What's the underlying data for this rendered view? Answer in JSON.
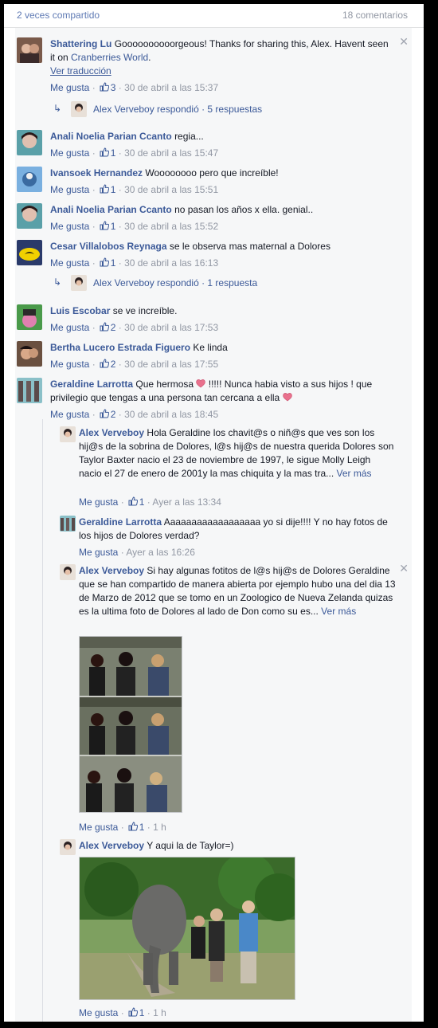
{
  "header": {
    "shares": "2 veces compartido",
    "comments": "18 comentarios"
  },
  "comments": [
    {
      "name": "Shattering Lu",
      "text": "Goooooooooorgeous! Thanks for sharing this, Alex. Havent seen it on ",
      "link": "Cranberries World",
      "tail": ".",
      "translate": "Ver traducción",
      "like": "Me gusta",
      "count": "3",
      "time": "30 de abril a las 15:37",
      "replies": "Alex Verveboy respondió · 5 respuestas"
    },
    {
      "name": "Anali Noelia Parian Ccanto",
      "text": "regia...",
      "like": "Me gusta",
      "count": "1",
      "time": "30 de abril a las 15:47"
    },
    {
      "name": "Ivansoek Hernandez",
      "text": "Woooooooo pero que increíble!",
      "like": "Me gusta",
      "count": "1",
      "time": "30 de abril a las 15:51"
    },
    {
      "name": "Anali Noelia Parian Ccanto",
      "text": "no pasan los años x ella. genial..",
      "like": "Me gusta",
      "count": "1",
      "time": "30 de abril a las 15:52"
    },
    {
      "name": "Cesar Villalobos Reynaga",
      "text": "se le observa mas maternal a Dolores",
      "like": "Me gusta",
      "count": "1",
      "time": "30 de abril a las 16:13",
      "replies": "Alex Verveboy respondió · 1 respuesta"
    },
    {
      "name": "Luis Escobar",
      "text": "se ve increíble.",
      "like": "Me gusta",
      "count": "2",
      "time": "30 de abril a las 17:53"
    },
    {
      "name": "Bertha Lucero Estrada Figuero",
      "text": "Ke linda",
      "like": "Me gusta",
      "count": "2",
      "time": "30 de abril a las 17:55"
    },
    {
      "name": "Geraldine Larrotta",
      "text": "Que hermosa ",
      "text2": " !!!!! Nunca habia visto a sus hijos ! que privilegio que tengas a una persona tan cercana a ella ",
      "like": "Me gusta",
      "count": "2",
      "time": "30 de abril a las 18:45"
    }
  ],
  "replies": [
    {
      "name": "Alex Verveboy",
      "text": "Hola Geraldine los chavit@s o niñ@s que ves son los hij@s de la sobrina de Dolores, l@s hij@s de nuestra querida Dolores son Taylor Baxter nacio el 23 de noviembre de 1997, le sigue Molly Leigh nacio el 27 de enero de 2001y la mas chiquita y la mas tra... ",
      "more": "Ver más",
      "like": "Me gusta",
      "count": "1",
      "time": "Ayer a las 13:34"
    },
    {
      "name": "Geraldine Larrotta",
      "text": "Aaaaaaaaaaaaaaaaaa yo si dije!!!! Y no hay fotos de los hijos de Dolores verdad?",
      "like": "Me gusta",
      "time": "Ayer a las 16:26"
    },
    {
      "name": "Alex Verveboy",
      "text": "Si hay algunas fotitos de l@s hij@s de Dolores Geraldine que se han compartido de manera abierta por ejemplo hubo una del dia 13 de Marzo de 2012 que se tomo en un Zoologico de Nueva Zelanda quizas es la ultima foto de Dolores al lado de Don como su es... ",
      "more": "Ver más",
      "like": "Me gusta",
      "count": "1",
      "time": "1 h"
    },
    {
      "name": "Alex Verveboy",
      "text": "Y aqui la de Taylor=)",
      "like": "Me gusta",
      "count": "1",
      "time": "1 h"
    }
  ],
  "colors": {
    "link": "#3b5998",
    "meta": "#9197a3",
    "heart": "#e9718d",
    "bg": "#f6f7f8"
  }
}
